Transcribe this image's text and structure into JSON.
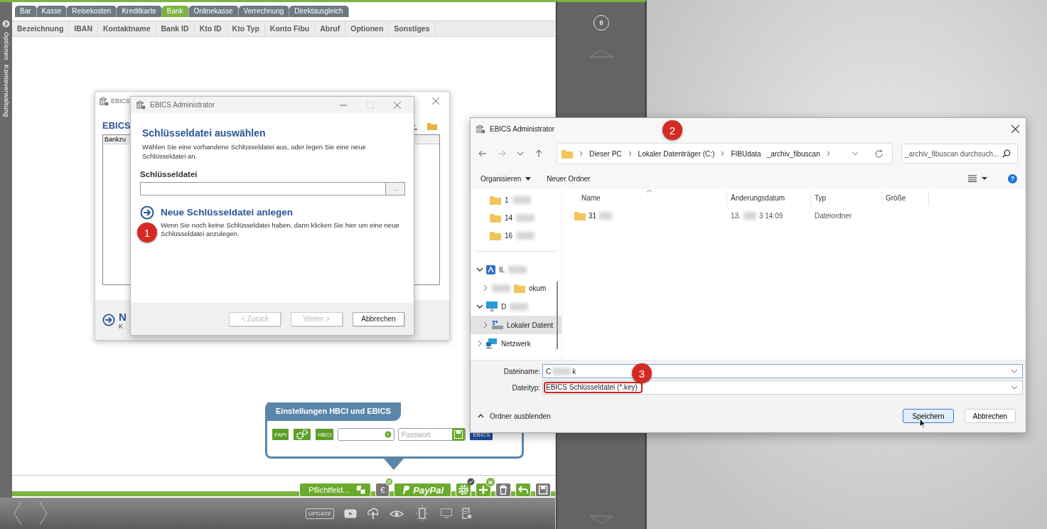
{
  "app": {
    "side_labels": [
      "Optionen",
      "Kontoverwaltung"
    ],
    "tabs": [
      {
        "label": "Bar",
        "selected": false
      },
      {
        "label": "Kasse",
        "selected": false
      },
      {
        "label": "Reisekosten",
        "selected": false
      },
      {
        "label": "Kreditkarte",
        "selected": false
      },
      {
        "label": "Bank",
        "selected": true
      },
      {
        "label": "Onlinekasse",
        "selected": false
      },
      {
        "label": "Verrechnung",
        "selected": false
      },
      {
        "label": "Direktausgleich",
        "selected": false
      }
    ],
    "columns": [
      "Bezeichnung",
      "IBAN",
      "Kontaktname",
      "Bank ID",
      "Kto ID",
      "Kto Typ",
      "Konto Fibu",
      "Abruf",
      "Optionen",
      "Sonstiges"
    ],
    "popup": {
      "title": "Einstellungen HBCI und EBICS",
      "controls": [
        {
          "kind": "button",
          "label": "FAPI"
        },
        {
          "kind": "gears"
        },
        {
          "kind": "button",
          "label": "HBCI"
        },
        {
          "kind": "input"
        },
        {
          "kind": "password",
          "placeholder": "Passwort"
        },
        {
          "kind": "ebics",
          "label": "EBICS"
        }
      ]
    },
    "footer_buttons": [
      {
        "kind": "pflichtfeld",
        "label": "Pflichtfeld..."
      },
      {
        "kind": "euro",
        "label": "€"
      },
      {
        "kind": "paypal",
        "label": "PayPal"
      },
      {
        "kind": "gear"
      },
      {
        "kind": "plus",
        "badge": "M"
      },
      {
        "kind": "trash"
      },
      {
        "kind": "undo"
      },
      {
        "kind": "save"
      }
    ],
    "bottom_toolbar": [
      {
        "kind": "update",
        "label": "UPDATE"
      },
      {
        "kind": "video"
      },
      {
        "kind": "cloud"
      },
      {
        "kind": "eye"
      },
      {
        "kind": "phone"
      },
      {
        "kind": "monitor"
      },
      {
        "kind": "document"
      }
    ],
    "counter": "0"
  },
  "back_dialog": {
    "title": "EBICS",
    "heading": "EBICS",
    "column": "Bankzu",
    "link": "N",
    "link_text": "K"
  },
  "wizard": {
    "title": "EBICS Administrator",
    "heading": "Schlüsseldatei auswählen",
    "intro": "Wählen Sie eine vorhandene Schlüsseldatei aus, oder legen Sie eine neue Schlüsseldatei an.",
    "field_label": "Schlüsseldatei",
    "browse": "...",
    "link": "Neue Schlüsseldatei anlegen",
    "link_text": "Wenn Sie noch keine Schlüsseldatei haben, dann klicken Sie hier um eine neue Schlüsseldatei anzulegen.",
    "buttons": [
      {
        "label": "< Zurück",
        "disabled": true
      },
      {
        "label": "Weiter >",
        "disabled": true
      },
      {
        "label": "Abbrechen",
        "disabled": false
      }
    ]
  },
  "file_dialog": {
    "title": "EBICS Administrator",
    "breadcrumb": [
      "Dieser PC",
      "Lokaler Datenträger (C:)",
      "FIBUdata",
      "_archiv_fibuscan"
    ],
    "search_placeholder": "_archiv_fibuscan durchsuch...",
    "organize": "Organisieren",
    "new_folder": "Neuer Ordner",
    "help": "?",
    "quick_access": [
      {
        "label": "1",
        "kind": "folder",
        "blurred": true,
        "selected": false
      },
      {
        "label": "14",
        "kind": "folder",
        "blurred": true,
        "selected": false
      },
      {
        "label": "16",
        "kind": "folder",
        "blurred": true,
        "selected": false
      }
    ],
    "tree": [
      {
        "label": "IL",
        "kind": "cloud",
        "blurred": true,
        "expanded": true,
        "selected": false,
        "children": [
          {
            "label": "okum",
            "kind": "folder",
            "blurred_prefix": true,
            "expanded": false,
            "selected": false
          }
        ]
      },
      {
        "label": "D",
        "kind": "pc",
        "blurred": true,
        "expanded": true,
        "selected": false,
        "children": [
          {
            "label": "Lokaler Datent",
            "kind": "drive",
            "expanded": false,
            "selected": true
          }
        ]
      },
      {
        "label": "Netzwerk",
        "kind": "network",
        "expanded": false,
        "selected": false
      }
    ],
    "columns": [
      "Name",
      "Änderungsdatum",
      "Typ",
      "Größe"
    ],
    "files": [
      {
        "name": "31",
        "date_start": "13.",
        "date_end": "3 14:09",
        "type": "Dateiordner"
      }
    ],
    "filename_label": "Dateiname:",
    "filename_start": "C",
    "filename_end": "k",
    "filetype_label": "Dateityp:",
    "filetype": "EBICS Schlüsseldatei (*.key)",
    "hide_folders": "Ordner ausblenden",
    "buttons": [
      {
        "label": "Speichern",
        "selected": true
      },
      {
        "label": "Abbrechen",
        "selected": false
      }
    ]
  },
  "markers": [
    "1",
    "2",
    "3"
  ]
}
